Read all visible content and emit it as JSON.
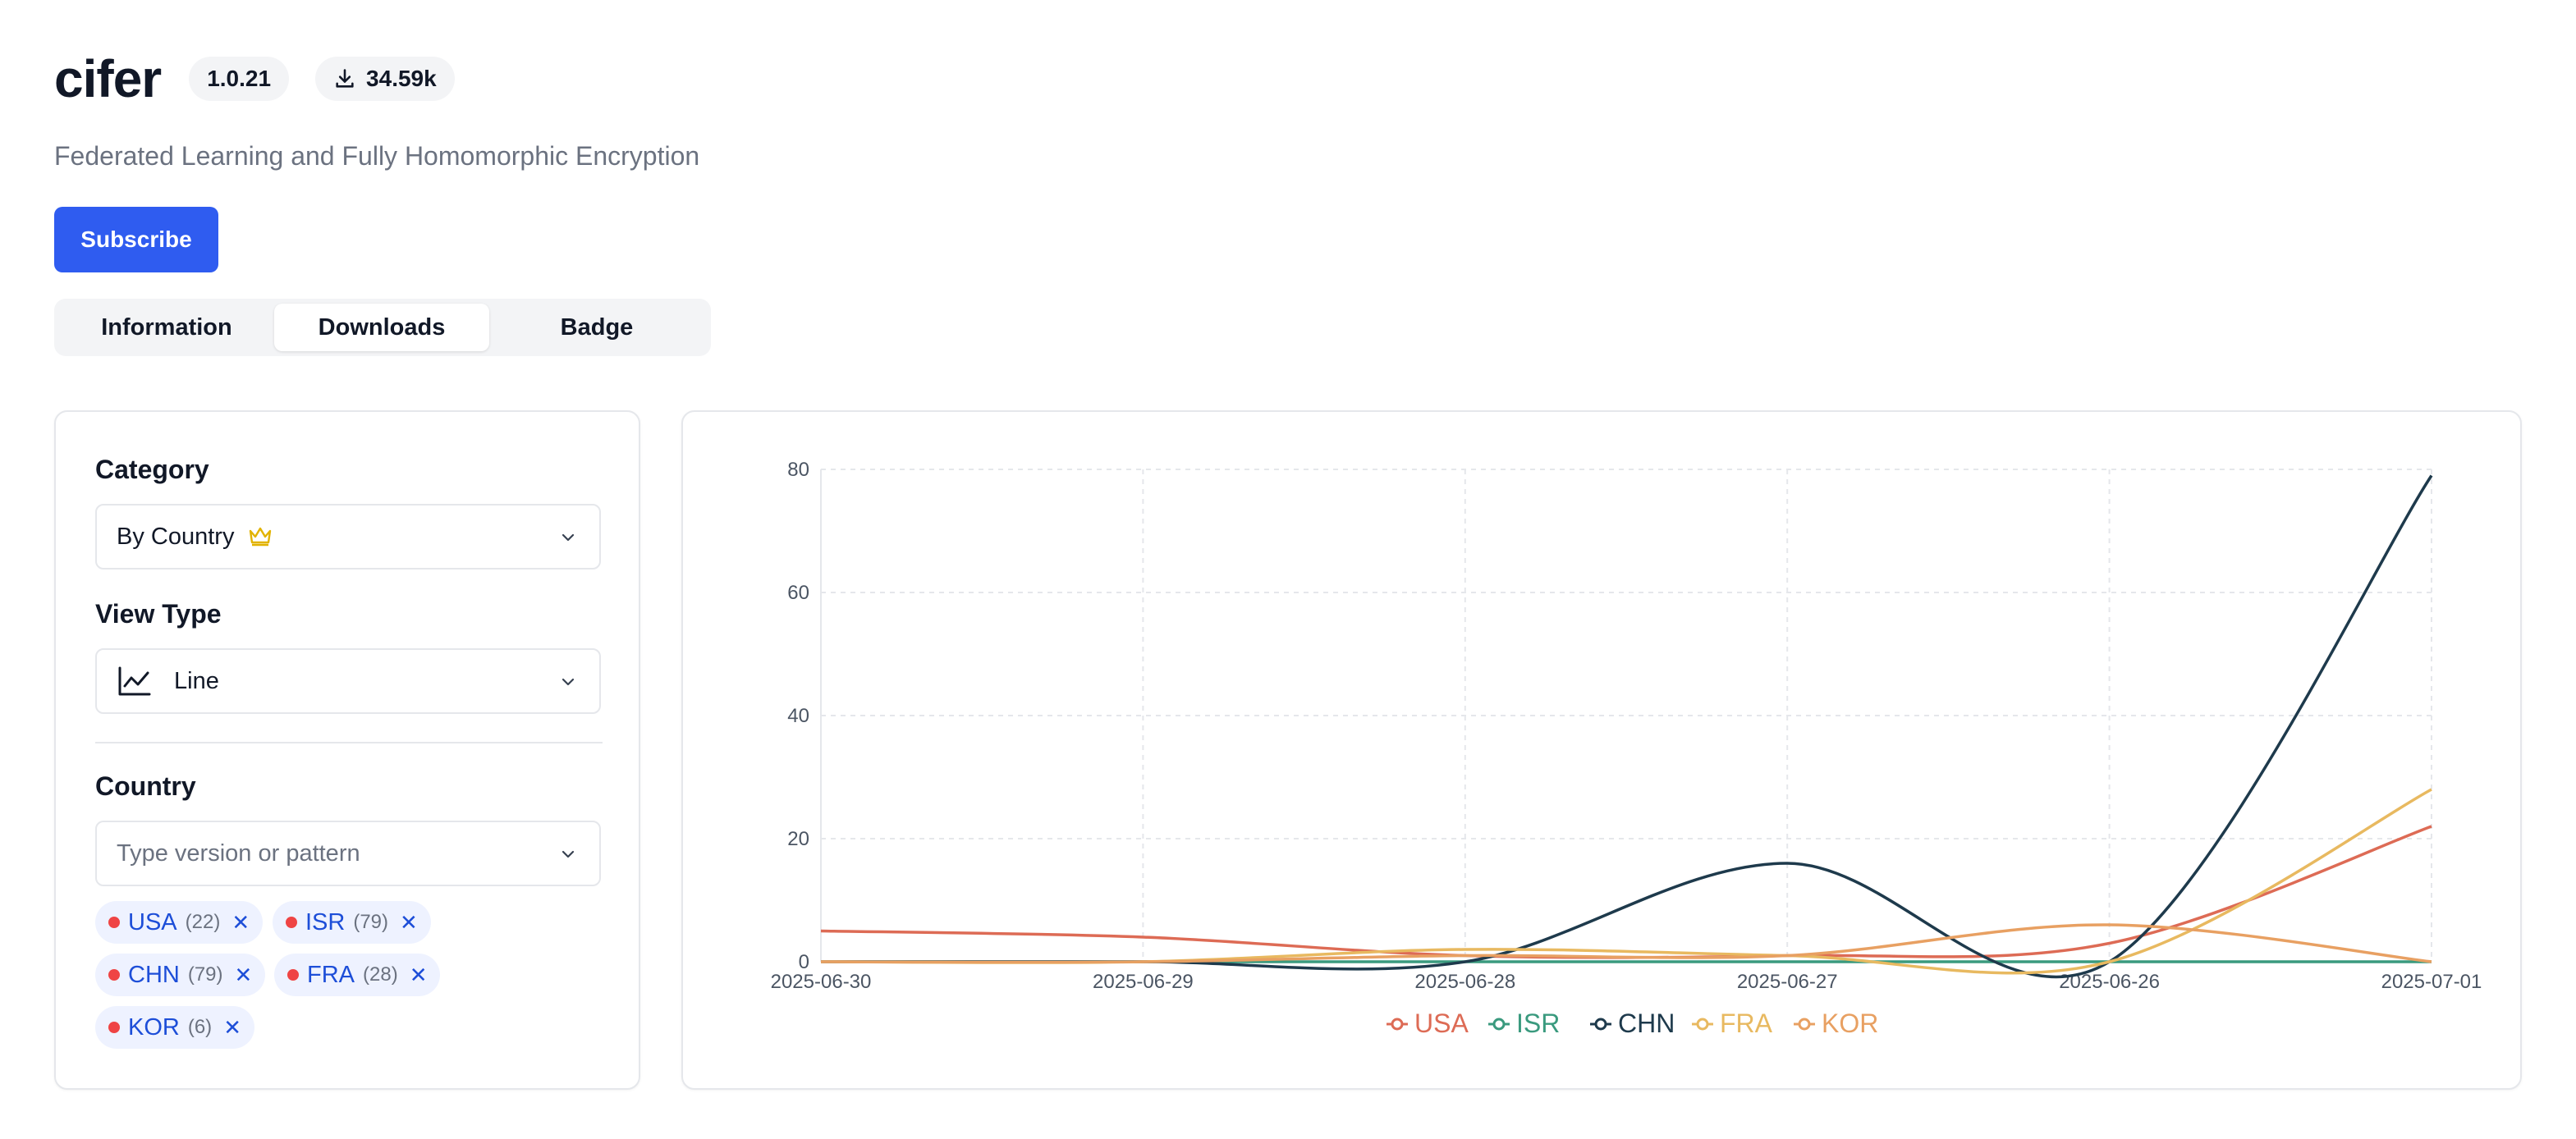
{
  "package": {
    "name": "cifer",
    "version": "1.0.21",
    "downloads": "34.59k",
    "description": "Federated Learning and Fully Homomorphic Encryption"
  },
  "subscribe_label": "Subscribe",
  "tabs": [
    {
      "label": "Information",
      "active": false
    },
    {
      "label": "Downloads",
      "active": true
    },
    {
      "label": "Badge",
      "active": false
    }
  ],
  "filters": {
    "category_label": "Category",
    "category_value": "By Country",
    "category_icon": "crown-icon",
    "view_type_label": "View Type",
    "view_type_value": "Line",
    "view_type_icon": "line-chart-icon",
    "country_label": "Country",
    "country_placeholder": "Type version or pattern",
    "countries": [
      {
        "code": "USA",
        "count": "(22)"
      },
      {
        "code": "ISR",
        "count": "(79)"
      },
      {
        "code": "CHN",
        "count": "(79)"
      },
      {
        "code": "FRA",
        "count": "(28)"
      },
      {
        "code": "KOR",
        "count": "(6)"
      }
    ],
    "chip_dot_color": "#ef4444"
  },
  "chart_data": {
    "type": "line",
    "x": [
      "2025-06-30",
      "2025-06-29",
      "2025-06-28",
      "2025-06-27",
      "2025-06-26",
      "2025-07-01"
    ],
    "ylim": [
      0,
      80
    ],
    "yticks": [
      0,
      20,
      40,
      60,
      80
    ],
    "grid": true,
    "legend_position": "bottom",
    "series": [
      {
        "name": "USA",
        "color": "#dd6b55",
        "values": [
          5,
          4,
          1,
          1,
          3,
          22
        ]
      },
      {
        "name": "ISR",
        "color": "#3a9a7e",
        "values": [
          0,
          0,
          0,
          0,
          0,
          0
        ]
      },
      {
        "name": "CHN",
        "color": "#1e3a4c",
        "values": [
          0,
          0,
          0,
          16,
          0,
          79
        ]
      },
      {
        "name": "FRA",
        "color": "#e8b960",
        "values": [
          0,
          0,
          2,
          1,
          0,
          28
        ]
      },
      {
        "name": "KOR",
        "color": "#e8a062",
        "values": [
          0,
          0,
          1,
          1,
          6,
          0
        ]
      }
    ]
  }
}
